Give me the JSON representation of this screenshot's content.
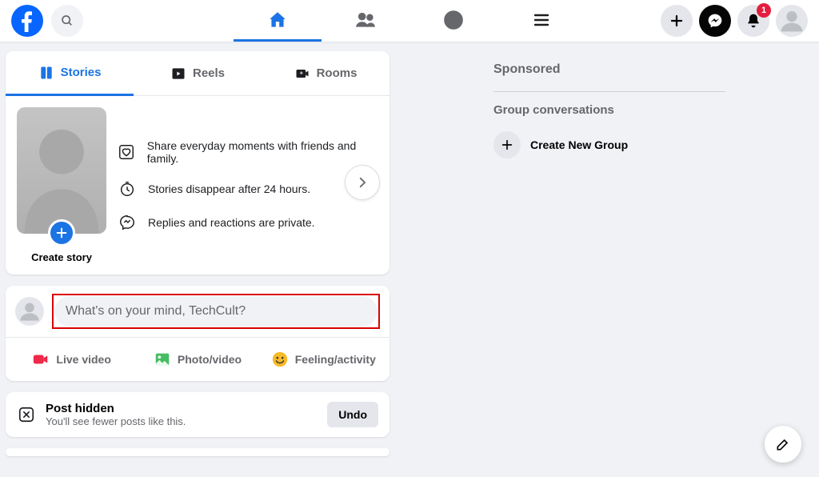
{
  "topbar": {
    "notification_count": "1"
  },
  "tabs": {
    "stories": "Stories",
    "reels": "Reels",
    "rooms": "Rooms"
  },
  "story": {
    "create_label": "Create story",
    "info1": "Share everyday moments with friends and family.",
    "info2": "Stories disappear after 24 hours.",
    "info3": "Replies and reactions are private."
  },
  "composer": {
    "placeholder": "What's on your mind, TechCult?",
    "live": "Live video",
    "photo": "Photo/video",
    "feeling": "Feeling/activity"
  },
  "hidden": {
    "title": "Post hidden",
    "subtitle": "You'll see fewer posts like this.",
    "undo": "Undo"
  },
  "rightcol": {
    "sponsored": "Sponsored",
    "group_header": "Group conversations",
    "create_group": "Create New Group"
  }
}
